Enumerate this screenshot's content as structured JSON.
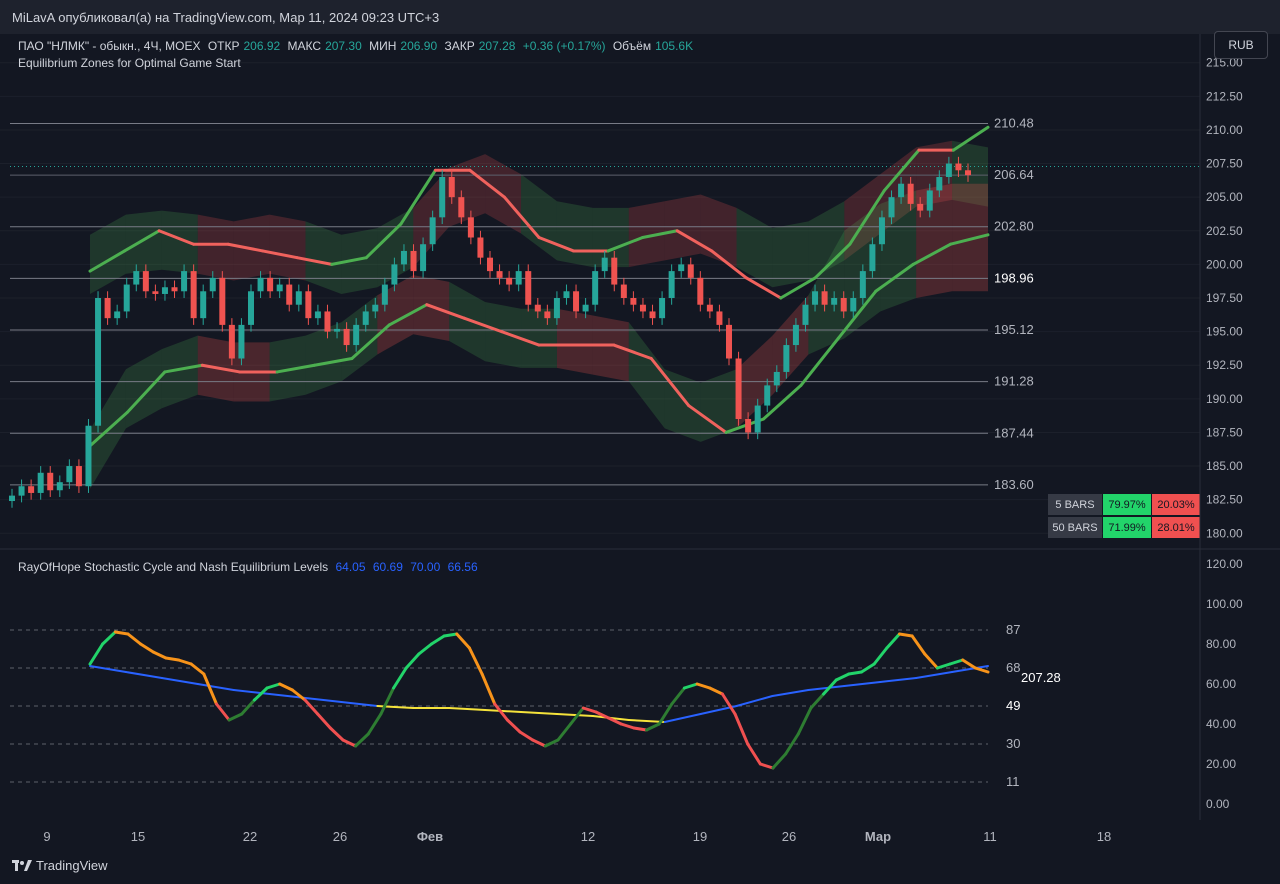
{
  "topbar": {
    "text": "MiLavA опубликовал(а) на TradingView.com, Мар 11, 2024 09:23 UTC+3"
  },
  "header": {
    "symbol": "ПАО \"НЛМК\" - обыкн., 4Ч, MOEX",
    "open_label": "ОТКР",
    "open_value": "206.92",
    "high_label": "МАКС",
    "high_value": "207.30",
    "low_label": "МИН",
    "low_value": "206.90",
    "close_label": "ЗАКР",
    "close_value": "207.28",
    "change": "+0.36 (+0.17%)",
    "volume_label": "Объём",
    "volume_value": "105.6K",
    "indicator1": "Equilibrium Zones for Optimal Game Start"
  },
  "currency_button": "RUB",
  "osc_header": {
    "name": "RayOfHope Stochastic Cycle and Nash Equilibrium Levels",
    "v1": "64.05",
    "v2": "60.69",
    "v3": "70.00",
    "v4": "66.56"
  },
  "footer": {
    "brand": "TradingView"
  },
  "colors": {
    "bg": "#131722",
    "up": "#26a69a",
    "down": "#ef5350",
    "green_line": "#4caf50",
    "red_line": "#f0625d",
    "blue_line": "#2962ff",
    "yellow_line": "#f5e33b",
    "orange": "#f7931a"
  },
  "chart_data": [
    {
      "type": "candlestick",
      "title": "ПАО \"НЛМК\" - обыкн., 4Ч, MOEX",
      "y_axis_ticks": [
        "215.00",
        "212.50",
        "210.00",
        "207.50",
        "205.00",
        "202.50",
        "200.00",
        "197.50",
        "195.00",
        "192.50",
        "190.00",
        "187.50",
        "185.00",
        "182.50",
        "180.00"
      ],
      "ylim": [
        179.5,
        215.5
      ],
      "x_axis_ticks": [
        "9",
        "15",
        "22",
        "26",
        "Фев",
        "12",
        "19",
        "26",
        "Мар",
        "11",
        "18"
      ],
      "current_price": 206.64,
      "levels": [
        210.48,
        206.64,
        202.8,
        198.96,
        195.12,
        191.28,
        187.44,
        183.6
      ],
      "level_labels": [
        "210.48",
        "206.64",
        "202.80",
        "198.96",
        "195.12",
        "191.28",
        "187.44",
        "183.60"
      ],
      "close_path": [
        182.8,
        183.5,
        183.0,
        184.5,
        183.2,
        183.8,
        185.0,
        183.5,
        188.0,
        197.5,
        196.0,
        196.5,
        198.5,
        199.5,
        198.0,
        197.8,
        198.3,
        198.0,
        199.5,
        196.0,
        198.0,
        199.0,
        195.5,
        193.0,
        195.5,
        198.0,
        199.0,
        198.0,
        198.5,
        197.0,
        198.0,
        196.0,
        196.5,
        195.0,
        195.2,
        194.0,
        195.5,
        196.5,
        197.0,
        198.5,
        200.0,
        201.0,
        199.5,
        201.5,
        203.5,
        206.5,
        205.0,
        203.5,
        202.0,
        200.5,
        199.5,
        199.0,
        198.5,
        199.5,
        197.0,
        196.5,
        196.0,
        197.5,
        198.0,
        196.5,
        197.0,
        199.5,
        200.5,
        198.5,
        197.5,
        197.0,
        196.5,
        196.0,
        197.5,
        199.5,
        200.0,
        199.0,
        197.0,
        196.5,
        195.5,
        193.0,
        188.5,
        187.5,
        189.5,
        191.0,
        192.0,
        194.0,
        195.5,
        197.0,
        198.0,
        197.0,
        197.5,
        196.5,
        197.5,
        199.5,
        201.5,
        203.5,
        205.0,
        206.0,
        204.5,
        204.0,
        205.5,
        206.5,
        207.5,
        207.0,
        206.64
      ],
      "band_upper_center": [
        200.0,
        201.5,
        201.8,
        201.5,
        201.0,
        201.5,
        201.0,
        200.0,
        200.5,
        202.0,
        205.0,
        206.0,
        204.5,
        202.5,
        202.0,
        202.0,
        202.5,
        203.0,
        202.0,
        200.5,
        201.0,
        202.5,
        204.5,
        206.5,
        207.0,
        206.5
      ],
      "band_lower_center": [
        185.5,
        190.0,
        191.5,
        192.5,
        192.0,
        192.0,
        192.5,
        193.5,
        195.5,
        197.0,
        196.5,
        195.0,
        194.5,
        194.5,
        194.0,
        193.5,
        190.0,
        189.0,
        190.0,
        192.5,
        195.5,
        198.5,
        200.5,
        201.5,
        202.0,
        202.0
      ],
      "green_red_line_top": [
        199.5,
        201.0,
        202.5,
        201.5,
        201.5,
        201.0,
        200.5,
        200.0,
        200.5,
        203.0,
        207.0,
        207.0,
        205.0,
        202.0,
        201.0,
        201.0,
        202.0,
        202.5,
        201.0,
        199.0,
        197.5,
        199.0,
        201.5,
        205.5,
        208.5,
        208.5,
        210.2
      ],
      "green_red_line_bottom": [
        186.5,
        189.0,
        192.0,
        192.5,
        192.0,
        192.0,
        192.5,
        193.0,
        195.5,
        197.0,
        196.0,
        195.0,
        194.0,
        194.0,
        194.0,
        193.0,
        189.5,
        187.5,
        188.5,
        191.0,
        194.5,
        198.0,
        200.0,
        201.5,
        202.2
      ],
      "stats_table": [
        {
          "label": "5 BARS",
          "green": "79.97%",
          "red": "20.03%"
        },
        {
          "label": "50 BARS",
          "green": "71.99%",
          "red": "28.01%"
        }
      ]
    },
    {
      "type": "line",
      "title": "RayOfHope Stochastic Cycle and Nash Equilibrium Levels",
      "y_axis_ticks": [
        "120.00",
        "100.00",
        "80.00",
        "60.00",
        "40.00",
        "20.00",
        "0.00"
      ],
      "ylim": [
        -3,
        122
      ],
      "levels": [
        87,
        68,
        49,
        30,
        11
      ],
      "level_labels": [
        "87",
        "68",
        "49",
        "30",
        "11"
      ],
      "price_label": "207.28",
      "stochastic": [
        70,
        80,
        86,
        85,
        80,
        76,
        73,
        72,
        70,
        65,
        50,
        42,
        45,
        52,
        58,
        60,
        57,
        52,
        45,
        38,
        32,
        29,
        35,
        45,
        58,
        68,
        75,
        80,
        84,
        85,
        78,
        65,
        50,
        42,
        36,
        32,
        29,
        32,
        40,
        48,
        46,
        43,
        40,
        38,
        37,
        40,
        50,
        58,
        60,
        58,
        55,
        45,
        30,
        20,
        18,
        25,
        35,
        48,
        55,
        62,
        65,
        66,
        70,
        78,
        85,
        84,
        75,
        68,
        70,
        72,
        68,
        66
      ],
      "nash_line": [
        69,
        66,
        63,
        60,
        57,
        55,
        53,
        51,
        49,
        48,
        48,
        47,
        46,
        45,
        44,
        42,
        41,
        45,
        49,
        54,
        57,
        59,
        61,
        63,
        66,
        69
      ]
    }
  ]
}
